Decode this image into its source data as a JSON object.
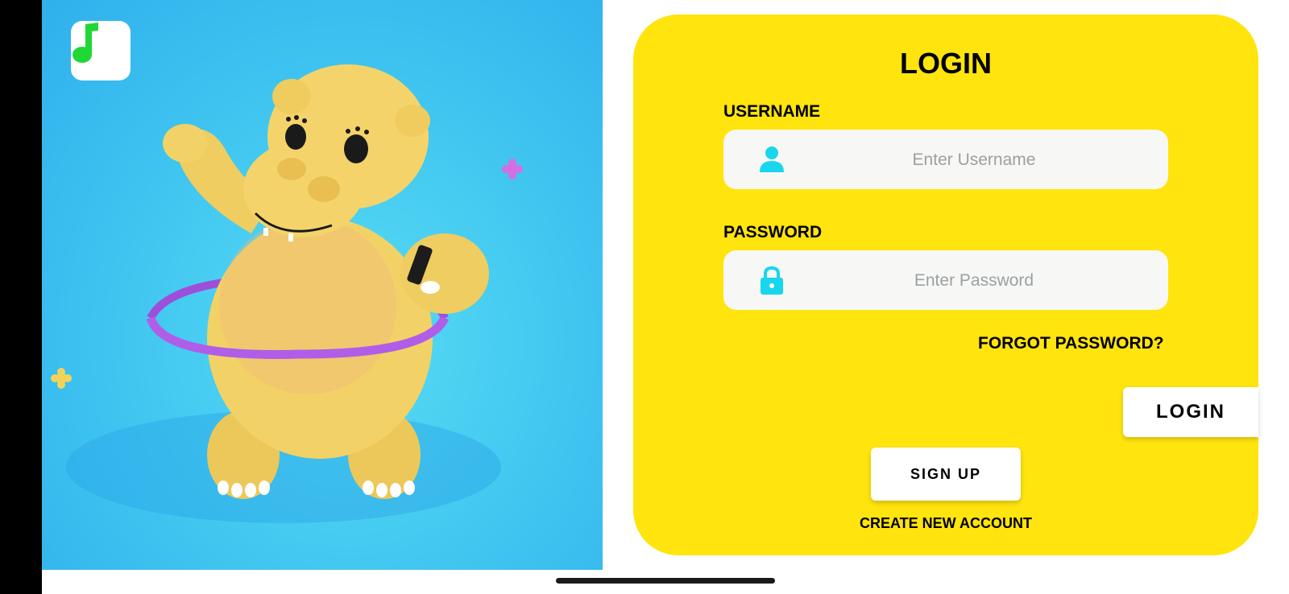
{
  "hero": {
    "app_icon": "music-note-icon",
    "illustration": "hippo-hula-hoop-illustration",
    "colors": {
      "background": "#3fc4f0",
      "hippo": "#f4d46a",
      "hoop": "#b05ee8",
      "note": "#1fd835"
    }
  },
  "login_card": {
    "title": "LOGIN",
    "background": "#ffe40d",
    "username": {
      "label": "USERNAME",
      "placeholder": "Enter Username",
      "value": "",
      "icon": "user-icon"
    },
    "password": {
      "label": "PASSWORD",
      "placeholder": "Enter Password",
      "value": "",
      "icon": "lock-icon"
    },
    "forgot_password": "FORGOT PASSWORD?",
    "login_button": "LOGIN",
    "signup_button": "SIGN UP",
    "create_account": "CREATE NEW ACCOUNT",
    "icon_color": "#18d6ee"
  }
}
